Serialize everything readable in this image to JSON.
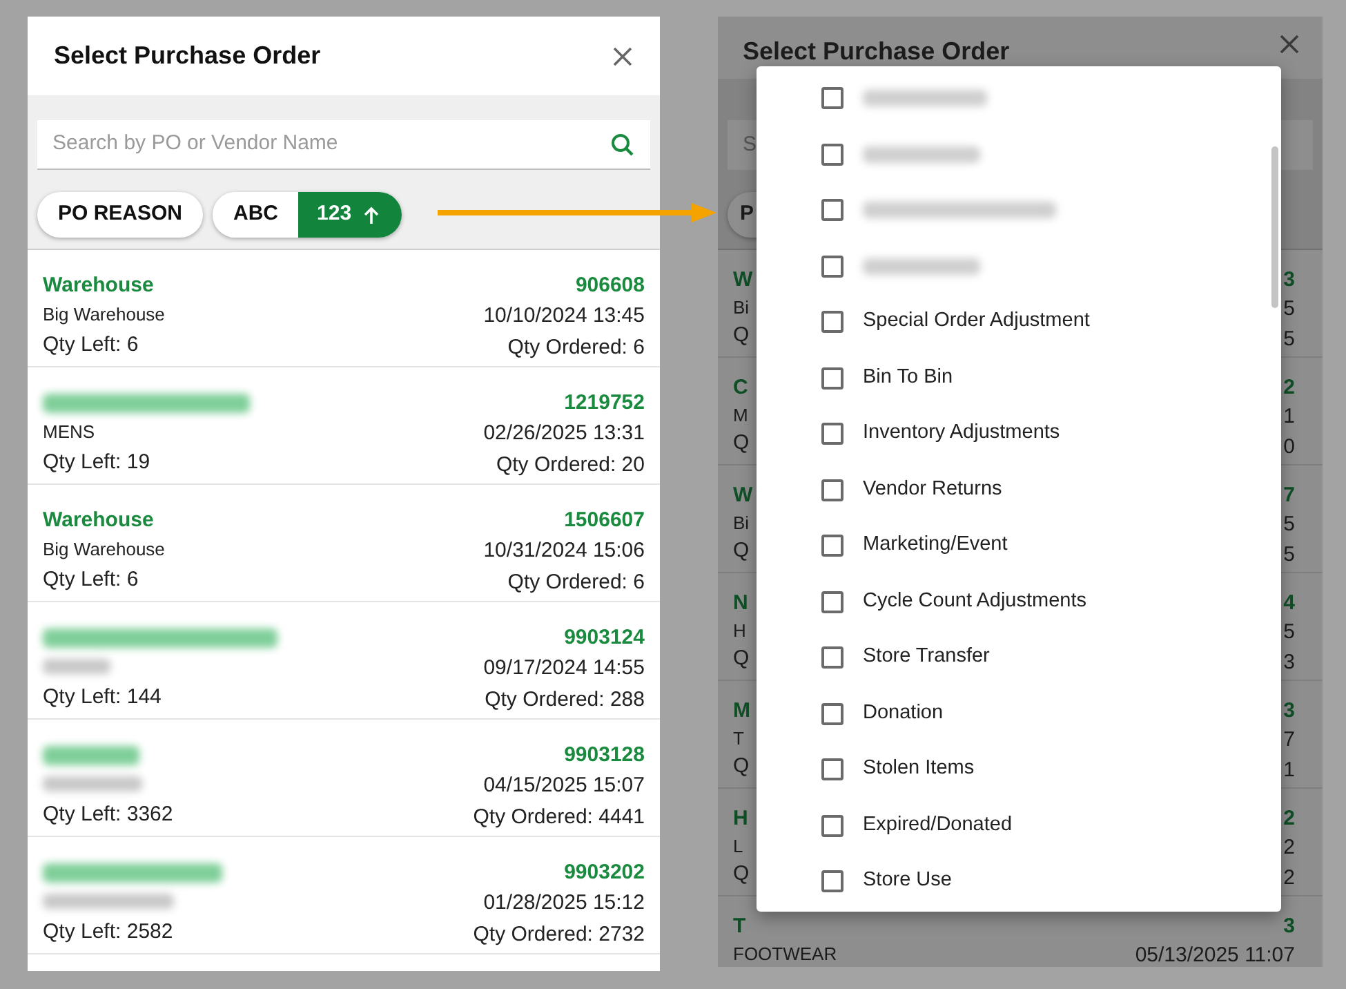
{
  "dialog": {
    "title": "Select Purchase Order",
    "search": {
      "placeholder": "Search by PO or Vendor Name"
    },
    "filter_chip": "PO REASON",
    "sort_options": [
      {
        "label": "ABC",
        "selected": false
      },
      {
        "label": "123",
        "selected": true
      }
    ],
    "rows": [
      {
        "vendor": "Warehouse",
        "department": "Big Warehouse",
        "qty_left": "Qty Left: 6",
        "po": "906608",
        "date": "10/10/2024 13:45",
        "qty_ordered": "Qty Ordered: 6"
      },
      {
        "vendor_redacted": true,
        "department": "MENS",
        "qty_left": "Qty Left: 19",
        "po": "1219752",
        "date": "02/26/2025 13:31",
        "qty_ordered": "Qty Ordered: 20"
      },
      {
        "vendor": "Warehouse",
        "department": "Big Warehouse",
        "qty_left": "Qty Left: 6",
        "po": "1506607",
        "date": "10/31/2024 15:06",
        "qty_ordered": "Qty Ordered: 6"
      },
      {
        "vendor_redacted": true,
        "department_redacted": true,
        "qty_left": "Qty Left: 144",
        "po": "9903124",
        "date": "09/17/2024 14:55",
        "qty_ordered": "Qty Ordered: 288"
      },
      {
        "vendor_redacted": true,
        "department_redacted": true,
        "qty_left": "Qty Left: 3362",
        "po": "9903128",
        "date": "04/15/2025 15:07",
        "qty_ordered": "Qty Ordered: 4441"
      },
      {
        "vendor_redacted": true,
        "department_redacted": true,
        "qty_left": "Qty Left: 2582",
        "po": "9903202",
        "date": "01/28/2025 15:12",
        "qty_ordered": "Qty Ordered: 2732"
      }
    ]
  },
  "background_dialog": {
    "title": "Select Purchase Order",
    "search_fragment": "S",
    "chip_fragment": "P",
    "rows": [
      {
        "vendor": "W",
        "department": "Bi",
        "qty_left": "Q",
        "po": "3",
        "date": "5",
        "qty_ordered": "5"
      },
      {
        "vendor": "C",
        "department": "M",
        "qty_left": "Q",
        "po": "2",
        "date": "1",
        "qty_ordered": "0"
      },
      {
        "vendor": "W",
        "department": "Bi",
        "qty_left": "Q",
        "po": "7",
        "date": "5",
        "qty_ordered": "5"
      },
      {
        "vendor": "N",
        "department": "H",
        "qty_left": "Q",
        "po": "4",
        "date": "5",
        "qty_ordered": "3"
      },
      {
        "vendor": "M",
        "department": "T",
        "qty_left": "Q",
        "po": "3",
        "date": "7",
        "qty_ordered": "1"
      },
      {
        "vendor": "H",
        "department": "L",
        "qty_left": "Q",
        "po": "2",
        "date": "2",
        "qty_ordered": "2"
      },
      {
        "vendor": "T",
        "department": "FOOTWEAR",
        "po": "3",
        "date": "05/13/2025 11:07"
      }
    ]
  },
  "reason_menu": {
    "items": [
      {
        "kind": "redacted",
        "checked": false
      },
      {
        "kind": "redacted",
        "checked": false
      },
      {
        "kind": "redacted",
        "checked": false
      },
      {
        "kind": "redacted",
        "checked": false
      },
      {
        "kind": "option",
        "label": "Special Order Adjustment",
        "checked": false
      },
      {
        "kind": "option",
        "label": "Bin To Bin",
        "checked": false
      },
      {
        "kind": "option",
        "label": "Inventory Adjustments",
        "checked": false
      },
      {
        "kind": "option",
        "label": "Vendor Returns",
        "checked": false
      },
      {
        "kind": "option",
        "label": "Marketing/Event",
        "checked": false
      },
      {
        "kind": "option",
        "label": "Cycle Count Adjustments",
        "checked": false
      },
      {
        "kind": "option",
        "label": "Store Transfer",
        "checked": false
      },
      {
        "kind": "option",
        "label": "Donation",
        "checked": false
      },
      {
        "kind": "option",
        "label": "Stolen Items",
        "checked": false
      },
      {
        "kind": "option",
        "label": "Expired/Donated",
        "checked": false
      },
      {
        "kind": "option",
        "label": "Store Use",
        "checked": false
      }
    ]
  }
}
